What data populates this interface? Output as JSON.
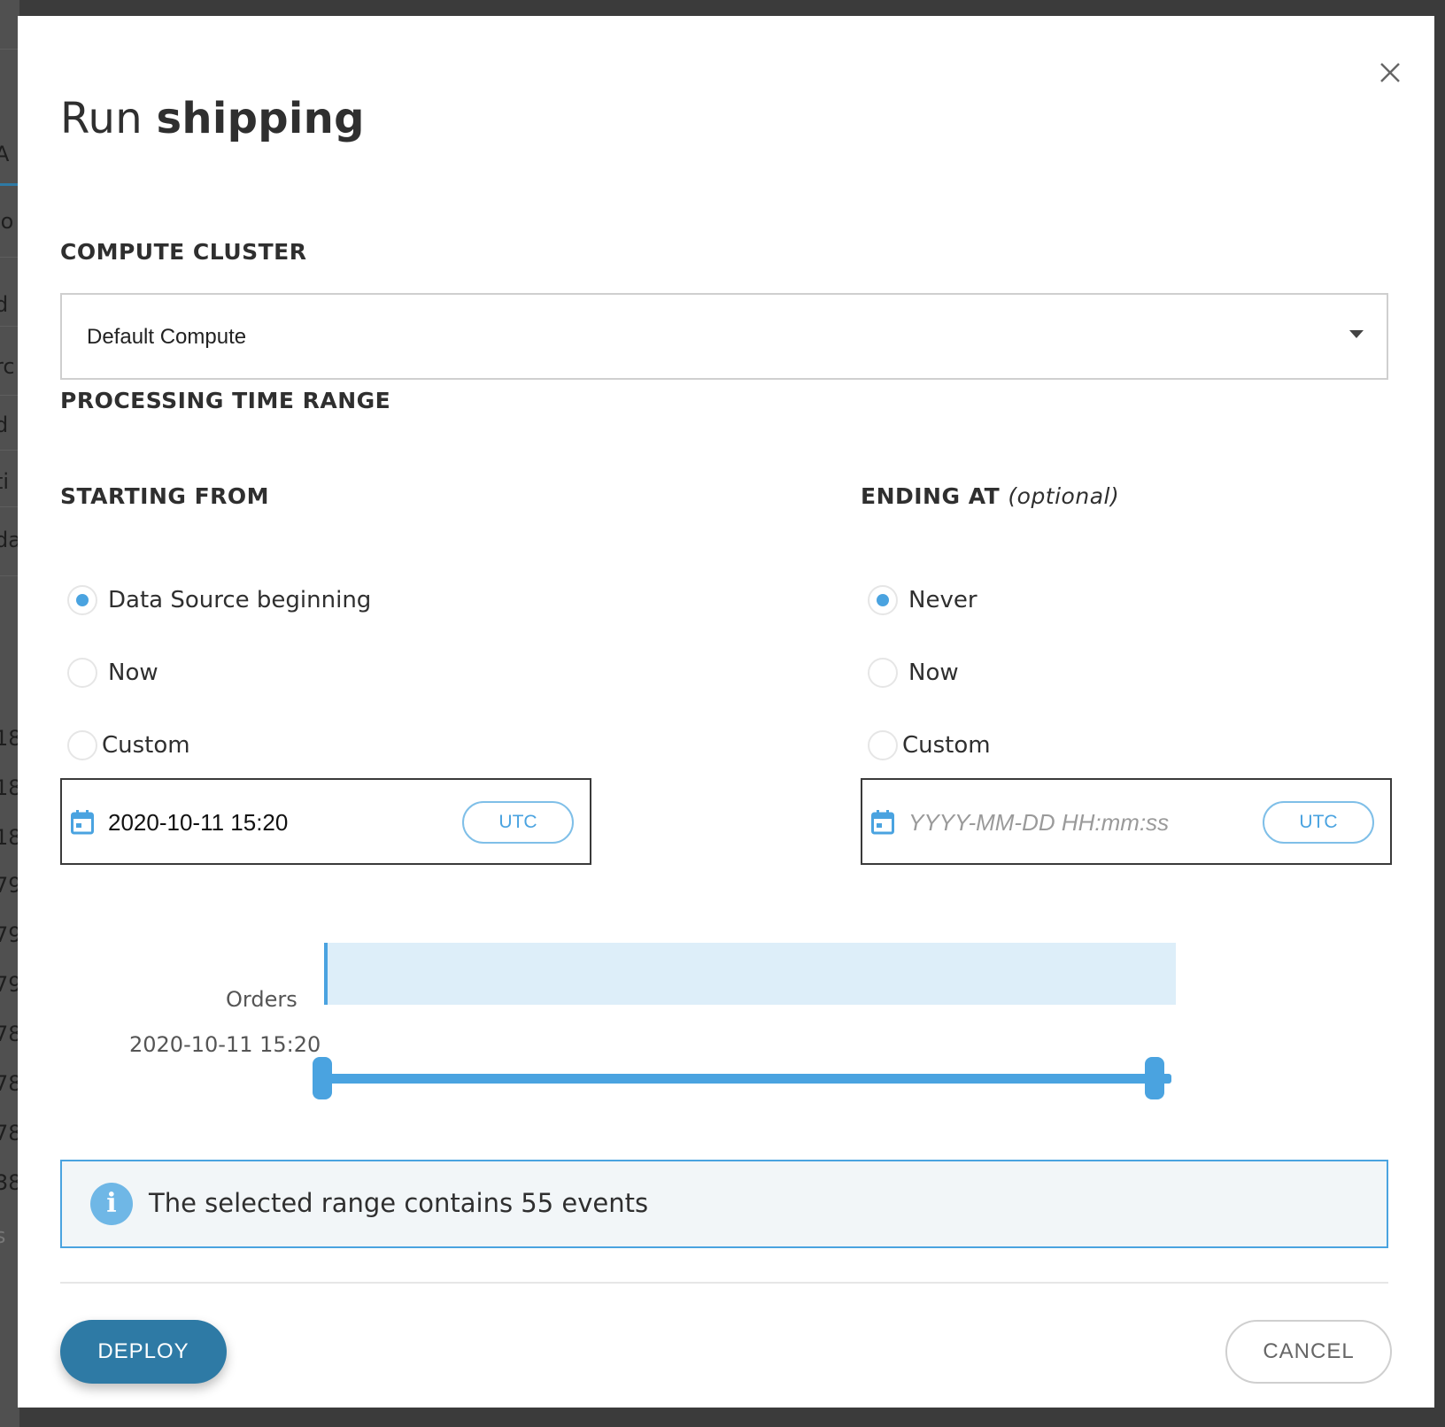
{
  "background_page": {
    "fragments": [
      "A (",
      "lo",
      "d",
      "rc",
      "d",
      "ti",
      "da",
      "18",
      "18",
      "18",
      "79",
      "79",
      "79",
      "78",
      "78",
      "78",
      "38",
      "s"
    ]
  },
  "modal": {
    "title_prefix": "Run",
    "title_name": "shipping",
    "close_icon": "close-icon"
  },
  "compute_cluster": {
    "label": "COMPUTE CLUSTER",
    "selected": "Default Compute"
  },
  "processing_time_range": {
    "label": "PROCESSING TIME RANGE"
  },
  "starting_from": {
    "label": "STARTING FROM",
    "options": [
      "Data Source beginning",
      "Now",
      "Custom"
    ],
    "selected_index": 0,
    "date_value": "2020-10-11 15:20",
    "date_placeholder": "YYYY-MM-DD HH:mm:ss",
    "timezone_button": "UTC"
  },
  "ending_at": {
    "label": "ENDING AT",
    "label_suffix": "(optional)",
    "options": [
      "Never",
      "Now",
      "Custom"
    ],
    "selected_index": 0,
    "date_value": "",
    "date_placeholder": "YYYY-MM-DD HH:mm:ss",
    "timezone_button": "UTC"
  },
  "timeline": {
    "source_label": "Orders",
    "start_label": "2020-10-11 15:20",
    "range_start_fraction": 0.0,
    "range_end_fraction": 1.0
  },
  "info": {
    "icon": "info-icon",
    "message": "The selected range contains 55 events"
  },
  "footer": {
    "deploy_label": "DEPLOY",
    "cancel_label": "CANCEL"
  },
  "colors": {
    "accent": "#4aa3e0",
    "primary_button": "#2e7aa5",
    "timeline_band": "#ddeef9",
    "info_background": "#f2f6f8"
  }
}
